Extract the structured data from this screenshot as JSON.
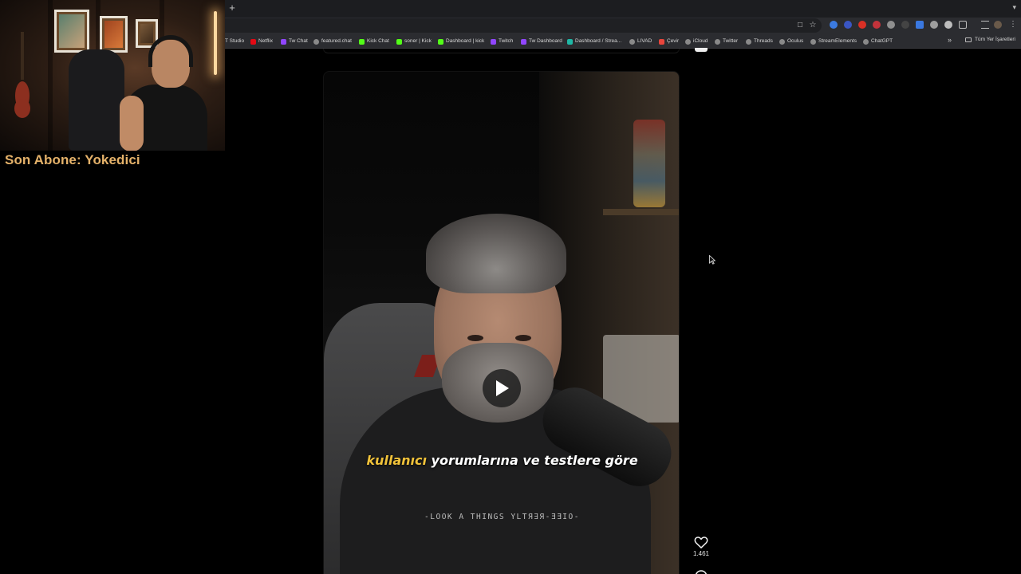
{
  "browser": {
    "new_tab_glyph": "+",
    "bookmarks": [
      {
        "label": "T Studio",
        "color": "#6b6b6b"
      },
      {
        "label": "Netflix",
        "color": "#e50914"
      },
      {
        "label": "Tw Chat",
        "color": "#9146ff"
      },
      {
        "label": "featured.chat",
        "color": "#8a8a8a"
      },
      {
        "label": "Kick Chat",
        "color": "#53fc18"
      },
      {
        "label": "soner | Kick",
        "color": "#53fc18"
      },
      {
        "label": "Dashboard | kick",
        "color": "#53fc18"
      },
      {
        "label": "Twitch",
        "color": "#9146ff"
      },
      {
        "label": "Tw Dashboard",
        "color": "#9146ff"
      },
      {
        "label": "Dashboard / Strea...",
        "color": "#1fb8a6"
      },
      {
        "label": "LIVAD",
        "color": "#8a8a8a"
      },
      {
        "label": "Çevir",
        "color": "#e8453c"
      },
      {
        "label": "iCloud",
        "color": "#8a8a8a"
      },
      {
        "label": "Twitter",
        "color": "#8a8a8a"
      },
      {
        "label": "Threads",
        "color": "#8a8a8a"
      },
      {
        "label": "Oculus",
        "color": "#8a8a8a"
      },
      {
        "label": "StreamElements",
        "color": "#8a8a8a"
      },
      {
        "label": "ChatGPT",
        "color": "#8a8a8a"
      }
    ],
    "all_bookmarks_label": "Tüm Yer İşaretleri",
    "more_glyph": "»"
  },
  "stream_overlay": {
    "last_subscriber": "Son Abone: Yokedici"
  },
  "video": {
    "caption_highlight": "kullanıcı",
    "caption_rest": " yorumlarına ve testlere göre",
    "shirt_text": "-LOOK A  THINGS  YLTЯ∃Я-ƎƎIO-"
  },
  "actions": {
    "like_count": "1.461"
  },
  "colors": {
    "overlay_text": "#e5b26a",
    "caption_highlight": "#f0c23a"
  }
}
